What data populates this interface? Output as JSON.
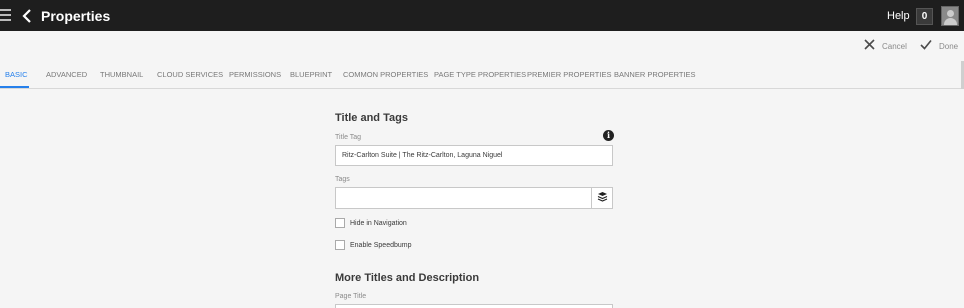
{
  "topbar": {
    "title": "Properties",
    "help_label": "Help",
    "notification_count": "0"
  },
  "actions": {
    "cancel_label": "Cancel",
    "done_label": "Done"
  },
  "tabs": [
    {
      "label": "BASIC",
      "active": true
    },
    {
      "label": "ADVANCED"
    },
    {
      "label": "THUMBNAIL"
    },
    {
      "label": "CLOUD SERVICES"
    },
    {
      "label": "PERMISSIONS"
    },
    {
      "label": "BLUEPRINT"
    },
    {
      "label": "COMMON PROPERTIES"
    },
    {
      "label": "PAGE TYPE PROPERTIES"
    },
    {
      "label": "PREMIER PROPERTIES"
    },
    {
      "label": "BANNER PROPERTIES"
    }
  ],
  "form": {
    "section1_title": "Title and Tags",
    "title_tag_label": "Title Tag",
    "title_tag_value": "Ritz-Carlton Suite | The Ritz-Carlton, Laguna Niguel",
    "tags_label": "Tags",
    "tags_value": "",
    "hide_in_nav_label": "Hide in Navigation",
    "enable_speedbump_label": "Enable Speedbump",
    "section2_title": "More Titles and Description",
    "page_title_label": "Page Title"
  },
  "colors": {
    "topbar_bg": "#1e1e1e",
    "accent": "#2680eb",
    "page_bg": "#f5f5f5"
  },
  "icons": {
    "menu": "hamburger-icon",
    "back": "chevron-left-icon",
    "cancel": "close-icon",
    "done": "checkmark-icon",
    "info": "info-icon",
    "tags": "tag-icon",
    "user": "avatar"
  }
}
